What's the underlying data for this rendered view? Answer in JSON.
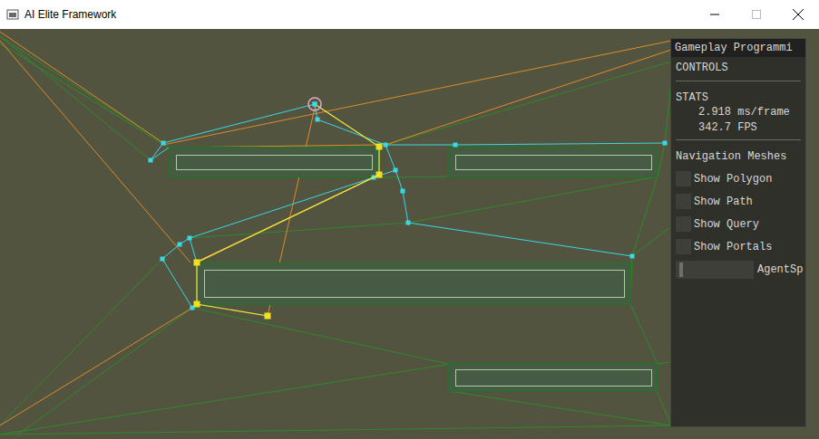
{
  "window": {
    "title": "AI Elite Framework"
  },
  "panel": {
    "title": "Gameplay Programmi",
    "controls_header": {
      "label": "CONTROLS",
      "expanded": false
    },
    "stats": {
      "header": "STATS",
      "lines": [
        "2.918 ms/frame",
        "342.7 FPS"
      ]
    },
    "navmesh": {
      "header": "Navigation Meshes",
      "options": [
        {
          "label": "Show Polygon",
          "checked": false
        },
        {
          "label": "Show Path",
          "checked": false
        },
        {
          "label": "Show Query",
          "checked": false
        },
        {
          "label": "Show Portals",
          "checked": false
        }
      ]
    },
    "slider": {
      "label": "AgentSp",
      "level": 0.02
    }
  }
}
